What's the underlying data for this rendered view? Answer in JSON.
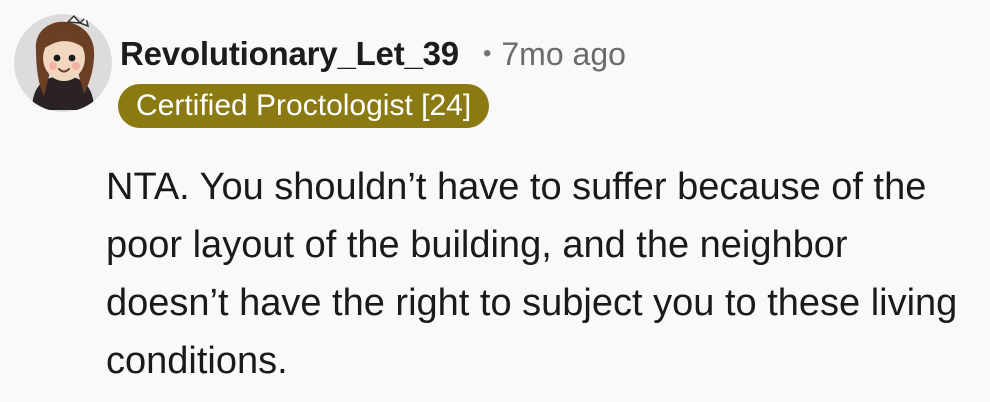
{
  "comment": {
    "author": "Revolutionary_Let_39",
    "separator": "•",
    "timestamp": "7mo ago",
    "flair": "Certified Proctologist [24]",
    "text": "NTA. You shouldn’t have to suffer because of the poor layout of the building, and the neighbor doesn’t have the right to subject you to these living conditions.",
    "avatar_icon": "user-avatar-icon"
  },
  "colors": {
    "background": "#faf9f8",
    "flair_background": "#8b7a12",
    "flair_text": "#ffffff",
    "username": "#1c1c1c",
    "timestamp": "#6b6b6b",
    "body_text": "#1a1a1b"
  }
}
